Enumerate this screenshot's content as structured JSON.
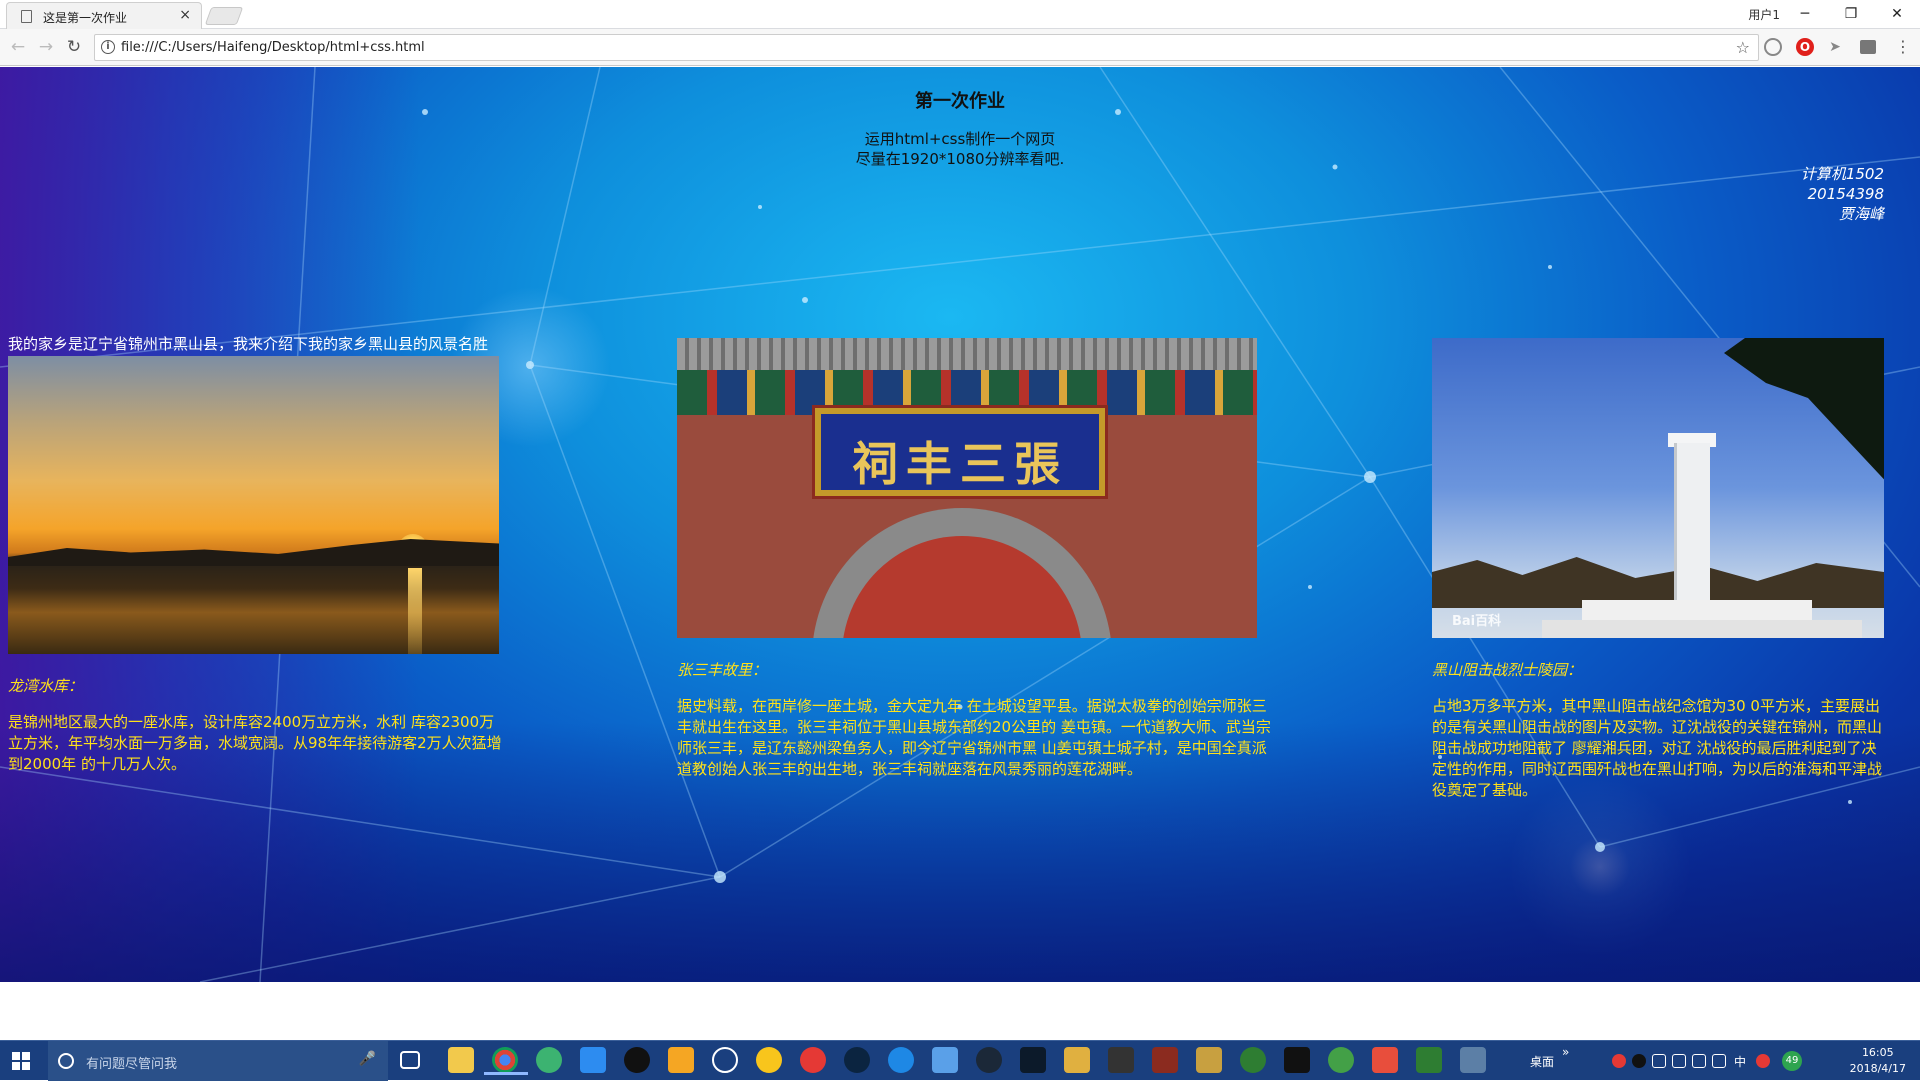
{
  "browser": {
    "tab_title": "这是第一次作业",
    "tab_close": "×",
    "user_label": "用户1",
    "win_min": "─",
    "win_max": "❐",
    "win_close": "✕",
    "nav_back": "←",
    "nav_forward": "→",
    "nav_reload": "↻",
    "info_icon": "i",
    "url": "file:///C:/Users/Haifeng/Desktop/html+css.html",
    "star": "☆",
    "ext_opera": "O",
    "ext_cursor": "➤",
    "ext_menu": "⋮"
  },
  "page": {
    "heading": "第一次作业",
    "intro_line1": "运用html+css制作一个网页",
    "intro_line2": "尽量在1920*1080分辨率看吧.",
    "author_class": "计算机1502",
    "author_id": "20154398",
    "author_name": "贾海峰",
    "home_intro": "我的家乡是辽宁省锦州市黑山县，我来介绍下我的家乡黑山县的风景名胜",
    "spots": [
      {
        "title": "龙湾水库：",
        "text": "是锦州地区最大的一座水库，设计库容2400万立方米，水利 库容2300万立方米，年平均水面一万多亩，水域宽阔。从98年年接待游客2万人次猛增到2000年 的十几万人次。"
      },
      {
        "title": "张三丰故里：",
        "text": "据史料载，在西岸修一座土城，金大定九年 在土城设望平县。据说太极拳的创始宗师张三丰就出生在这里。张三丰祠位于黑山县城东部约20公里的 姜屯镇。一代道教大师、武当宗师张三丰，是辽东懿州梁鱼务人，即今辽宁省锦州市黑 山姜屯镇土城子村，是中国全真派道教创始人张三丰的出生地，张三丰祠就座落在风景秀丽的莲花湖畔。",
        "plaque": "祠丰三張"
      },
      {
        "title": "黑山阻击战烈士陵园：",
        "text": "占地3万多平方米，其中黑山阻击战纪念馆为30 0平方米，主要展出的是有关黑山阻击战的图片及实物。辽沈战役的关键在锦州，而黑山阻击战成功地阻截了 廖耀湘兵团，对辽 沈战役的最后胜利起到了决定性的作用，同时辽西围歼战也在黑山打响，为以后的淮海和平津战役奠定了基础。",
        "watermark": "Bai百科"
      }
    ]
  },
  "taskbar": {
    "search_placeholder": "有问题尽管问我",
    "mic": "🎤",
    "desktop_label": "桌面",
    "expand": "»",
    "ime": "中",
    "badge": "49",
    "time": "16:05",
    "date": "2018/4/17"
  }
}
